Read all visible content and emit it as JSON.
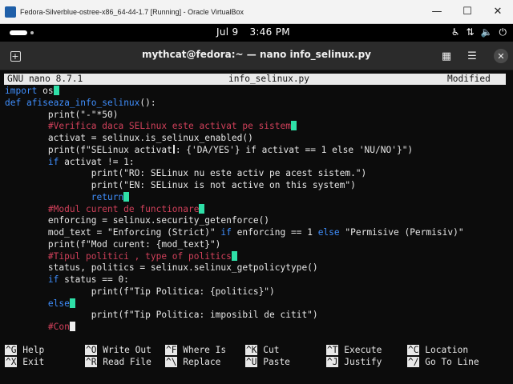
{
  "vbox": {
    "title": "Fedora-Silverblue-ostree-x86_64-44-1.7 [Running] - Oracle VirtualBox",
    "minimize": "—",
    "maximize": "☐",
    "close": "✕"
  },
  "gnome": {
    "date": "Jul 9",
    "time": "3:46 PM"
  },
  "terminal": {
    "title": "mythcat@fedora:~ — nano info_selinux.py"
  },
  "nano": {
    "version": "GNU nano 8.7.1",
    "filename": "info_selinux.py",
    "status": "Modified"
  },
  "code": {
    "l1_kw": "import",
    "l1_rest": " os",
    "l2_kw": "def",
    "l2_fn": " afiseaza_info_selinux",
    "l2_rest": "():",
    "l3": "        print(\"-\"*50)",
    "l4_cm": "        #Verifica daca SELinux este activat pe sistem",
    "l5": "        activat = selinux.is_selinux_enabled()",
    "l6_a": "        print(f\"SELinux activat",
    "l6_b": ": {'DA/YES'} if activat == 1 else 'NU/NO'}\")",
    "l7_kw": "        if",
    "l7_rest": " activat != 1:",
    "l8": "                print(\"RO: SELinux nu este activ pe acest sistem.\")",
    "l9": "                print(\"EN: SELinux is not active on this system\")",
    "l10_kw": "                return",
    "l11_cm": "        #Modul curent de functionare",
    "l12": "        enforcing = selinux.security_getenforce()",
    "l13_a": "        mod_text = \"Enforcing (Strict)\"",
    "l13_kw1": " if",
    "l13_b": " enforcing == 1",
    "l13_kw2": " else",
    "l13_c": " \"Permisive (Permisiv)\"",
    "l14": "        print(f\"Mod curent: {mod_text}\")",
    "l15_cm": "        #Tipul politici , type of politics",
    "l16": "        status, politics = selinux.selinux_getpolicytype()",
    "l17_kw": "        if",
    "l17_rest": " status == 0:",
    "l18": "                print(f\"Tip Politica: {politics}\")",
    "l19_kw": "        else",
    "l20": "                print(f\"Tip Politica: imposibil de citit\")",
    "l21_cm": "        #Con"
  },
  "shortcuts": [
    {
      "key": "^G",
      "label": "Help"
    },
    {
      "key": "^O",
      "label": "Write Out"
    },
    {
      "key": "^F",
      "label": "Where Is"
    },
    {
      "key": "^K",
      "label": "Cut"
    },
    {
      "key": "^T",
      "label": "Execute"
    },
    {
      "key": "^C",
      "label": "Location"
    },
    {
      "key": "^X",
      "label": "Exit"
    },
    {
      "key": "^R",
      "label": "Read File"
    },
    {
      "key": "^\\",
      "label": "Replace"
    },
    {
      "key": "^U",
      "label": "Paste"
    },
    {
      "key": "^J",
      "label": "Justify"
    },
    {
      "key": "^/",
      "label": "Go To Line"
    }
  ]
}
